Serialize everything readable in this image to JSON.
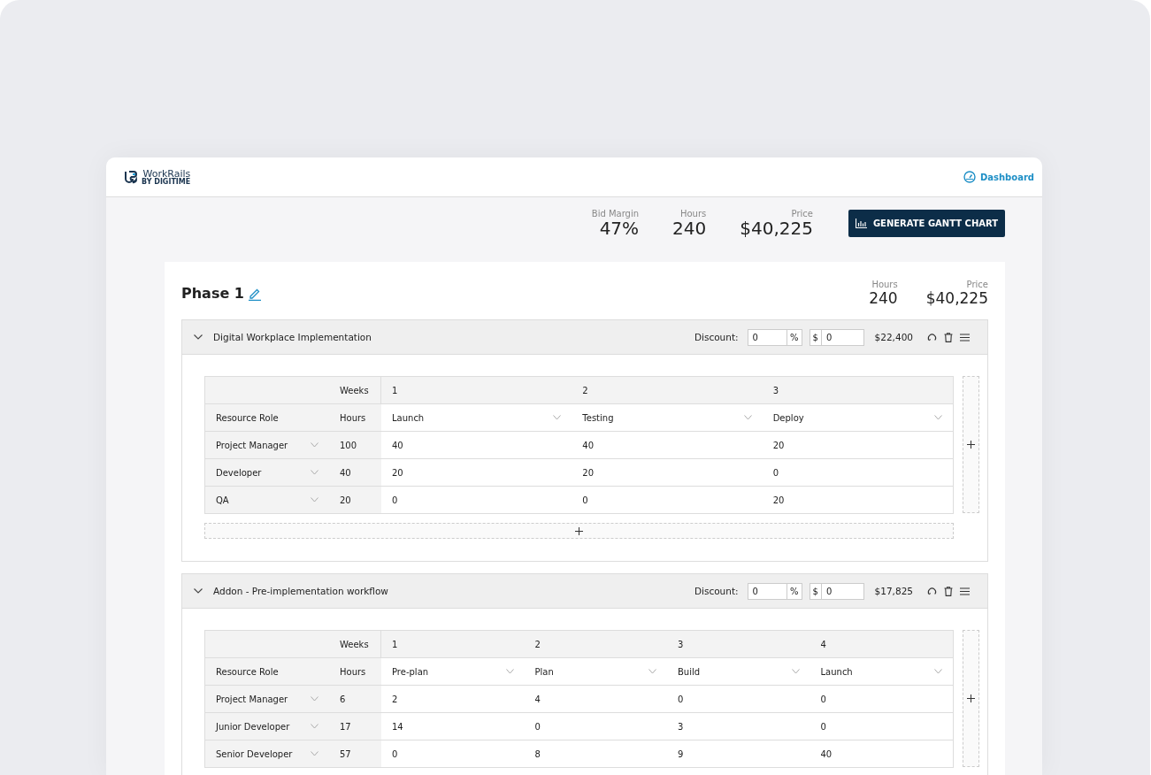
{
  "header": {
    "logo": {
      "name": "WorkRails",
      "byline": "BY DIGITIME"
    },
    "nav_link": "Dashboard"
  },
  "summary": {
    "stats": [
      {
        "label": "Bid Margin",
        "value": "47%"
      },
      {
        "label": "Hours",
        "value": "240"
      },
      {
        "label": "Price",
        "value": "$40,225"
      }
    ],
    "button": "GENERATE GANTT CHART"
  },
  "phase": {
    "title": "Phase 1",
    "stats": [
      {
        "label": "Hours",
        "value": "240"
      },
      {
        "label": "Price",
        "value": "$40,225"
      }
    ],
    "sections": [
      {
        "title": "Digital Workplace Implementation",
        "expanded": true,
        "discount_label": "Discount:",
        "percent": "0",
        "percent_unit": "%",
        "amount_unit": "$",
        "amount": "0",
        "total": "$22,400",
        "add_row": true,
        "table": {
          "weeks_label": "Weeks",
          "role_label": "Resource Role",
          "hours_label": "Hours",
          "weeks": [
            {
              "number": "1",
              "milestone": "Launch"
            },
            {
              "number": "2",
              "milestone": "Testing"
            },
            {
              "number": "3",
              "milestone": "Deploy"
            }
          ],
          "rows": [
            {
              "role": "Project Manager",
              "hours": "100",
              "values": [
                "40",
                "40",
                "20"
              ]
            },
            {
              "role": "Developer",
              "hours": "40",
              "values": [
                "20",
                "20",
                "0"
              ]
            },
            {
              "role": "QA",
              "hours": "20",
              "values": [
                "0",
                "0",
                "20"
              ]
            }
          ]
        }
      },
      {
        "title": "Addon - Pre-implementation workflow",
        "expanded": true,
        "discount_label": "Discount:",
        "percent": "0",
        "percent_unit": "%",
        "amount_unit": "$",
        "amount": "0",
        "total": "$17,825",
        "table": {
          "weeks_label": "Weeks",
          "role_label": "Resource Role",
          "hours_label": "Hours",
          "weeks": [
            {
              "number": "1",
              "milestone": "Pre-plan"
            },
            {
              "number": "2",
              "milestone": "Plan"
            },
            {
              "number": "3",
              "milestone": "Build"
            },
            {
              "number": "4",
              "milestone": "Launch"
            }
          ],
          "rows": [
            {
              "role": "Project Manager",
              "hours": "6",
              "values": [
                "2",
                "4",
                "0",
                "0"
              ]
            },
            {
              "role": "Junior Developer",
              "hours": "17",
              "values": [
                "14",
                "0",
                "3",
                "0"
              ]
            },
            {
              "role": "Senior Developer",
              "hours": "57",
              "values": [
                "0",
                "8",
                "9",
                "40"
              ]
            }
          ]
        }
      }
    ]
  }
}
